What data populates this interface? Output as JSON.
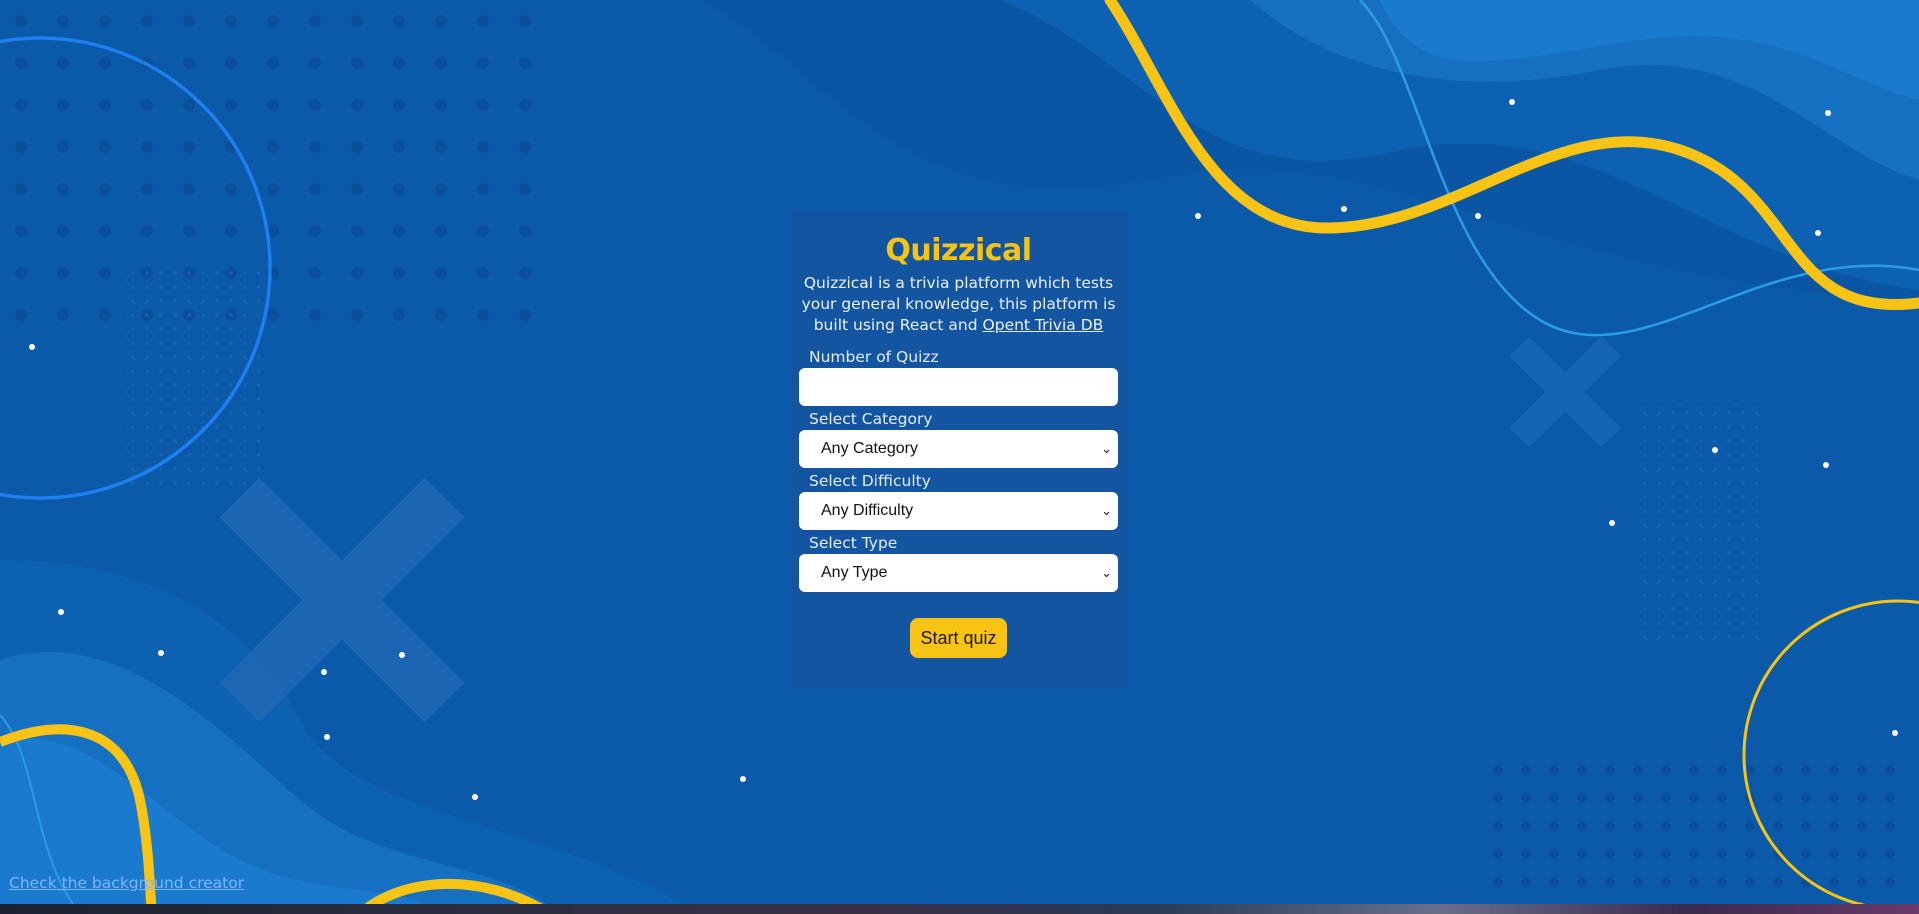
{
  "colors": {
    "background": "#0a5aa9",
    "accent": "#f7c314",
    "ring_blue": "#1e7ff0"
  },
  "card": {
    "title": "Quizzical",
    "description": "Quizzical is a trivia platform which tests your general knowledge, this platform is built using React and",
    "description_link": "Opent Trivia DB"
  },
  "form": {
    "number_label": "Number of Quizz",
    "number_value": "",
    "category_label": "Select Category",
    "category_value": "Any Category",
    "difficulty_label": "Select Difficulty",
    "difficulty_value": "Any Difficulty",
    "type_label": "Select Type",
    "type_value": "Any Type",
    "start_label": "Start quiz"
  },
  "footer": {
    "creator_link": "Check the background creator"
  },
  "icons": {
    "select_chevron": "chevron-down-icon"
  }
}
